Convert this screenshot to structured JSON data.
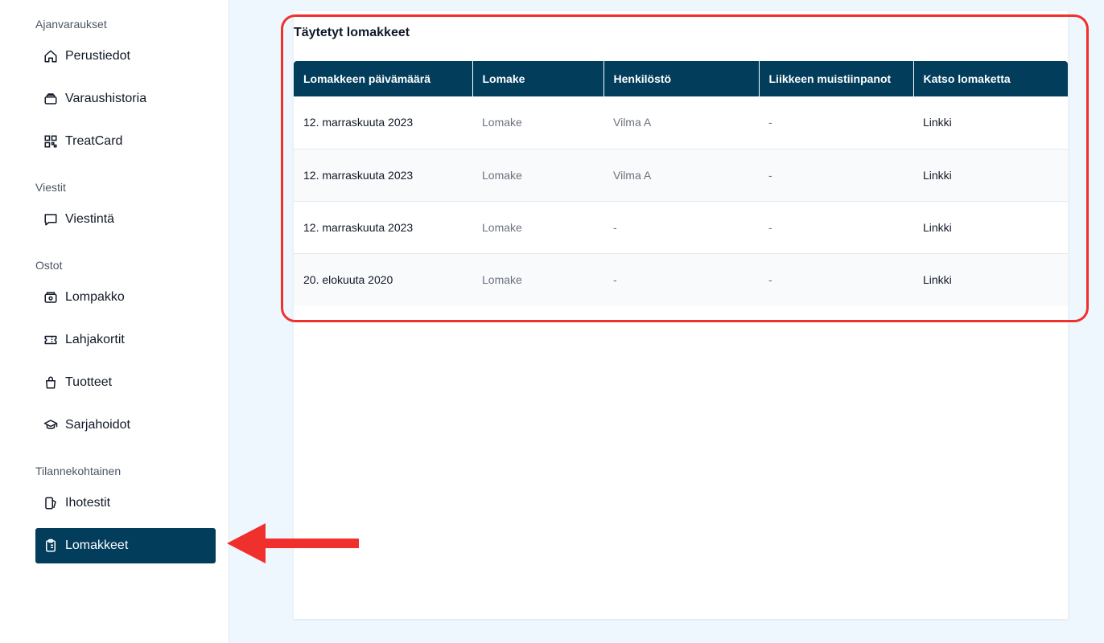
{
  "sidebar": {
    "sections": [
      {
        "title": "Ajanvaraukset"
      },
      {
        "title": "Viestit"
      },
      {
        "title": "Ostot"
      },
      {
        "title": "Tilannekohtainen"
      }
    ],
    "items": [
      {
        "label": "Perustiedot",
        "icon": "home-icon"
      },
      {
        "label": "Varaushistoria",
        "icon": "archive-icon"
      },
      {
        "label": "TreatCard",
        "icon": "qr-code-icon"
      },
      {
        "label": "Viestintä",
        "icon": "chat-icon"
      },
      {
        "label": "Lompakko",
        "icon": "wallet-icon"
      },
      {
        "label": "Lahjakortit",
        "icon": "ticket-icon"
      },
      {
        "label": "Tuotteet",
        "icon": "shopping-bag-icon"
      },
      {
        "label": "Sarjahoidot",
        "icon": "graduation-cap-icon"
      },
      {
        "label": "Ihotestit",
        "icon": "skin-test-icon"
      },
      {
        "label": "Lomakkeet",
        "icon": "clipboard-icon",
        "active": true
      }
    ]
  },
  "main": {
    "title": "Täytetyt lomakkeet",
    "columns": [
      "Lomakkeen päivämäärä",
      "Lomake",
      "Henkilöstö",
      "Liikkeen muistiinpanot",
      "Katso lomaketta"
    ],
    "rows": [
      {
        "date": "12. marraskuuta 2023",
        "form": "Lomake",
        "staff": "Vilma A",
        "notes": "-",
        "link": "Linkki"
      },
      {
        "date": "12. marraskuuta 2023",
        "form": "Lomake",
        "staff": "Vilma A",
        "notes": "-",
        "link": "Linkki"
      },
      {
        "date": "12. marraskuuta 2023",
        "form": "Lomake",
        "staff": "-",
        "notes": "-",
        "link": "Linkki"
      },
      {
        "date": "20. elokuuta 2020",
        "form": "Lomake",
        "staff": "-",
        "notes": "-",
        "link": "Linkki"
      }
    ]
  },
  "colors": {
    "brand": "#023d5c",
    "annotation": "#f0302c",
    "background": "#eef7fd"
  }
}
